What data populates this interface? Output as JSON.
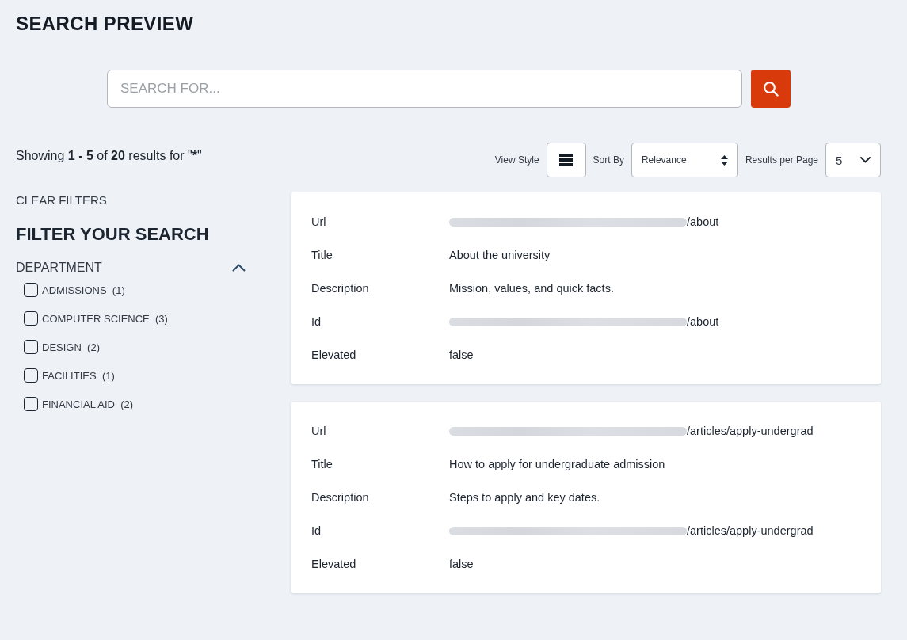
{
  "page": {
    "title": "SEARCH PREVIEW"
  },
  "search": {
    "placeholder": "SEARCH FOR..."
  },
  "summary": [
    {
      "text": "Showing ",
      "bold": false
    },
    {
      "text": "1 - 5",
      "bold": true
    },
    {
      "text": " of ",
      "bold": false
    },
    {
      "text": "20",
      "bold": true
    },
    {
      "text": " results for \"",
      "bold": false
    },
    {
      "text": "*",
      "bold": true
    },
    {
      "text": "\"",
      "bold": false
    }
  ],
  "controls": {
    "view_style": {
      "label": "View Style"
    },
    "sort": {
      "label": "Sort By",
      "value": "Relevance"
    },
    "per_page": {
      "label": "Results per Page",
      "value": "5"
    }
  },
  "sidebar": {
    "clear_filters": "CLEAR FILTERS",
    "heading": "FILTER YOUR SEARCH",
    "facets": [
      {
        "name": "DEPARTMENT",
        "expanded": true,
        "options": [
          {
            "label": "ADMISSIONS",
            "count": "(1)",
            "checked": false
          },
          {
            "label": "COMPUTER SCIENCE",
            "count": "(3)",
            "checked": false
          },
          {
            "label": "DESIGN",
            "count": "(2)",
            "checked": false
          },
          {
            "label": "FACILITIES",
            "count": "(1)",
            "checked": false
          },
          {
            "label": "FINANCIAL AID",
            "count": "(2)",
            "checked": false
          }
        ]
      }
    ]
  },
  "results": [
    {
      "fields": [
        {
          "label": "Url",
          "value": "/about",
          "redacted": true
        },
        {
          "label": "Title",
          "value": "About the university",
          "redacted": false
        },
        {
          "label": "Description",
          "value": "Mission, values, and quick facts.",
          "redacted": false
        },
        {
          "label": "Id",
          "value": "/about",
          "redacted": true
        },
        {
          "label": "Elevated",
          "value": "false",
          "redacted": false
        }
      ]
    },
    {
      "fields": [
        {
          "label": "Url",
          "value": "/articles/apply-undergrad",
          "redacted": true
        },
        {
          "label": "Title",
          "value": "How to apply for undergraduate admission",
          "redacted": false
        },
        {
          "label": "Description",
          "value": "Steps to apply and key dates.",
          "redacted": false
        },
        {
          "label": "Id",
          "value": "/articles/apply-undergrad",
          "redacted": true
        },
        {
          "label": "Elevated",
          "value": "false",
          "redacted": false
        }
      ]
    }
  ]
}
